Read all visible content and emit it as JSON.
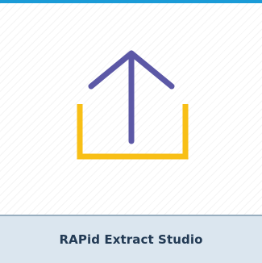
{
  "tile": {
    "title": "RAPid Extract Studio",
    "icon": "upload-arrow-icon"
  },
  "colors": {
    "accent_top": "#1a9bd7",
    "arrow": "#5c58a6",
    "tray": "#f8bf16",
    "footer_bg": "#dbe6ef",
    "divider": "#98aebf",
    "title_text": "#223a54"
  }
}
